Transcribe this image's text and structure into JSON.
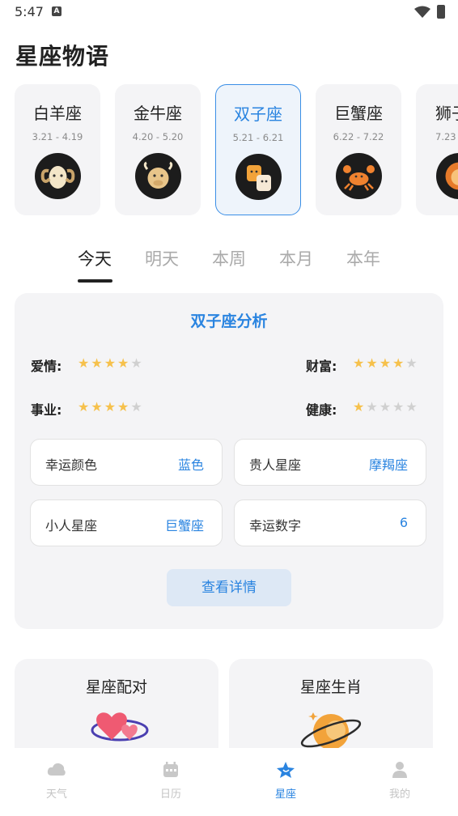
{
  "status": {
    "time": "5:47",
    "notif": "A"
  },
  "page": {
    "title": "星座物语"
  },
  "zodiac": [
    {
      "name": "白羊座",
      "dates": "3.21 - 4.19",
      "icon": "ram-icon"
    },
    {
      "name": "金牛座",
      "dates": "4.20 - 5.20",
      "icon": "bull-icon"
    },
    {
      "name": "双子座",
      "dates": "5.21 - 6.21",
      "icon": "twins-icon",
      "active": true
    },
    {
      "name": "巨蟹座",
      "dates": "6.22 - 7.22",
      "icon": "crab-icon"
    },
    {
      "name": "狮子座",
      "dates": "7.23",
      "icon": "lion-icon"
    }
  ],
  "tabs": [
    "今天",
    "明天",
    "本周",
    "本月",
    "本年"
  ],
  "analysis": {
    "title": "双子座分析",
    "ratings": [
      {
        "label": "爱情:",
        "score": 4,
        "max": 5
      },
      {
        "label": "财富:",
        "score": 4,
        "max": 5
      },
      {
        "label": "事业:",
        "score": 4,
        "max": 5
      },
      {
        "label": "健康:",
        "score": 1,
        "max": 5
      }
    ],
    "info": [
      {
        "key": "幸运颜色",
        "value": "蓝色"
      },
      {
        "key": "贵人星座",
        "value": "摩羯座"
      },
      {
        "key": "小人星座",
        "value": "巨蟹座"
      },
      {
        "key": "幸运数字",
        "value": "6"
      }
    ],
    "detail_button": "查看详情"
  },
  "features": [
    {
      "title": "星座配对",
      "icon": "hearts-icon"
    },
    {
      "title": "星座生肖",
      "icon": "planet-icon"
    }
  ],
  "nav": [
    {
      "label": "天气",
      "icon": "cloud-icon"
    },
    {
      "label": "日历",
      "icon": "calendar-icon"
    },
    {
      "label": "星座",
      "icon": "star-icon",
      "active": true
    },
    {
      "label": "我的",
      "icon": "person-icon"
    }
  ],
  "colors": {
    "accent": "#2a84e0",
    "star": "#f6c14c",
    "card_bg": "#f4f4f6"
  }
}
